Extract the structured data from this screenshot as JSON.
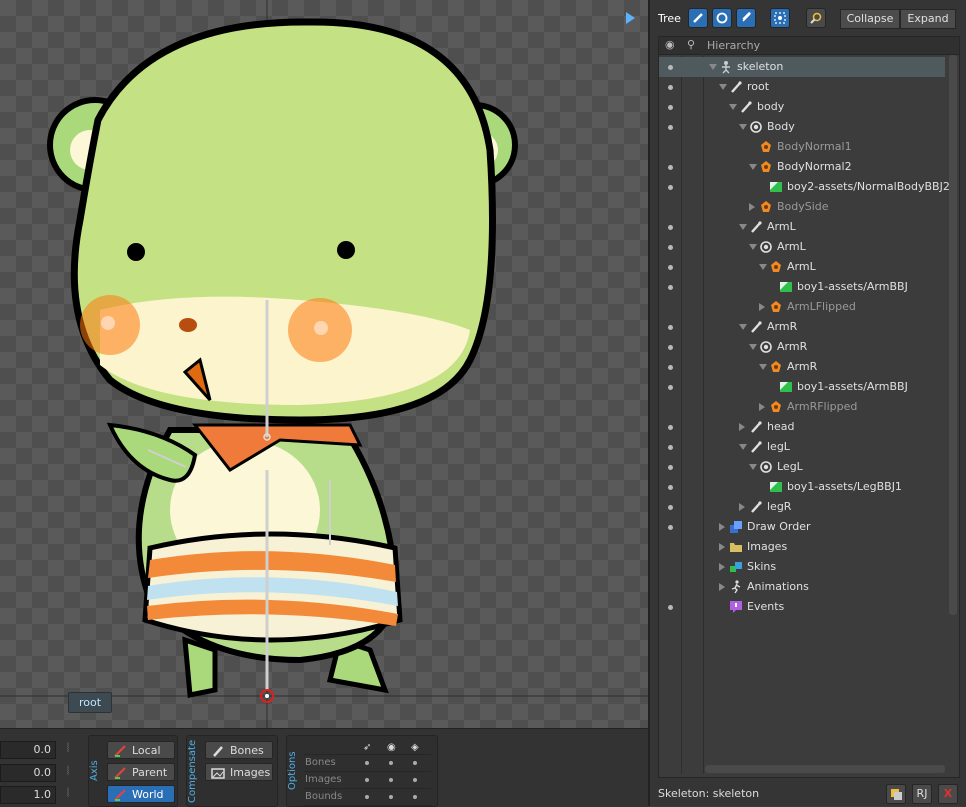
{
  "viewport": {
    "bone_tooltip": "root"
  },
  "transform": {
    "rotate_value": "0.0",
    "translate_value": "0.0",
    "scale_value": "1.0",
    "axis_label": "Axis",
    "axis_buttons": [
      "Local",
      "Parent",
      "World"
    ],
    "compensate_label": "Compensate",
    "compensate_buttons": [
      "Bones",
      "Images"
    ],
    "options_label": "Options",
    "options_rows": [
      "Bones",
      "Images",
      "Bounds"
    ]
  },
  "panel": {
    "tree_label": "Tree",
    "collapse_label": "Collapse",
    "expand_label": "Expand",
    "header_label": "Hierarchy",
    "status": "Skeleton: skeleton",
    "status_btn_r": "RJ",
    "status_btn_x": "X"
  },
  "tree": [
    {
      "label": "skeleton",
      "depth": 0,
      "icon": "skeleton-icon",
      "arrow": "down",
      "visible": true,
      "selected": true
    },
    {
      "label": "root",
      "depth": 1,
      "icon": "bone-icon",
      "arrow": "down",
      "visible": true
    },
    {
      "label": "body",
      "depth": 2,
      "icon": "bone-icon",
      "arrow": "down",
      "visible": true
    },
    {
      "label": "Body",
      "depth": 3,
      "icon": "slot-icon",
      "arrow": "down",
      "visible": true
    },
    {
      "label": "BodyNormal1",
      "depth": 4,
      "icon": "attachment-icon",
      "arrow": "none",
      "visible": false,
      "dim": true
    },
    {
      "label": "BodyNormal2",
      "depth": 4,
      "icon": "attachment-icon",
      "arrow": "down",
      "visible": true
    },
    {
      "label": "boy2-assets/NormalBodyBBJ2",
      "depth": 5,
      "icon": "image-icon",
      "arrow": "none",
      "visible": true
    },
    {
      "label": "BodySide",
      "depth": 4,
      "icon": "attachment-icon",
      "arrow": "right",
      "visible": false,
      "dim": true
    },
    {
      "label": "ArmL",
      "depth": 3,
      "icon": "bone-icon",
      "arrow": "down",
      "visible": true
    },
    {
      "label": "ArmL",
      "depth": 4,
      "icon": "slot-icon",
      "arrow": "down",
      "visible": true
    },
    {
      "label": "ArmL",
      "depth": 5,
      "icon": "attachment-icon",
      "arrow": "down",
      "visible": true
    },
    {
      "label": "boy1-assets/ArmBBJ",
      "depth": 6,
      "icon": "image-icon",
      "arrow": "none",
      "visible": true
    },
    {
      "label": "ArmLFlipped",
      "depth": 5,
      "icon": "attachment-icon",
      "arrow": "right",
      "visible": false,
      "dim": true
    },
    {
      "label": "ArmR",
      "depth": 3,
      "icon": "bone-icon",
      "arrow": "down",
      "visible": true
    },
    {
      "label": "ArmR",
      "depth": 4,
      "icon": "slot-icon",
      "arrow": "down",
      "visible": true
    },
    {
      "label": "ArmR",
      "depth": 5,
      "icon": "attachment-icon",
      "arrow": "down",
      "visible": true
    },
    {
      "label": "boy1-assets/ArmBBJ",
      "depth": 6,
      "icon": "image-icon",
      "arrow": "none",
      "visible": true
    },
    {
      "label": "ArmRFlipped",
      "depth": 5,
      "icon": "attachment-icon",
      "arrow": "right",
      "visible": false,
      "dim": true
    },
    {
      "label": "head",
      "depth": 3,
      "icon": "bone-icon",
      "arrow": "right",
      "visible": true
    },
    {
      "label": "legL",
      "depth": 3,
      "icon": "bone-icon",
      "arrow": "down",
      "visible": true
    },
    {
      "label": "LegL",
      "depth": 4,
      "icon": "slot-icon",
      "arrow": "down",
      "visible": true
    },
    {
      "label": "boy1-assets/LegBBJ1",
      "depth": 5,
      "icon": "image-icon",
      "arrow": "none",
      "visible": true
    },
    {
      "label": "legR",
      "depth": 3,
      "icon": "bone-icon",
      "arrow": "right",
      "visible": true
    },
    {
      "label": "Draw Order",
      "depth": 1,
      "icon": "draw-order-icon",
      "arrow": "right",
      "visible": true
    },
    {
      "label": "Images",
      "depth": 1,
      "icon": "folder-icon",
      "arrow": "right",
      "visible": false
    },
    {
      "label": "Skins",
      "depth": 1,
      "icon": "skins-icon",
      "arrow": "right",
      "visible": false
    },
    {
      "label": "Animations",
      "depth": 1,
      "icon": "animations-icon",
      "arrow": "right",
      "visible": false
    },
    {
      "label": "Events",
      "depth": 1,
      "icon": "events-icon",
      "arrow": "none",
      "visible": true
    }
  ],
  "colors": {
    "accent": "#2a6fb5",
    "bone": "#d0d0d0",
    "attachment": "#f08a24",
    "image": "#2fbf4a",
    "character_head": "#a9d97a",
    "blush": "#ff6a00"
  }
}
